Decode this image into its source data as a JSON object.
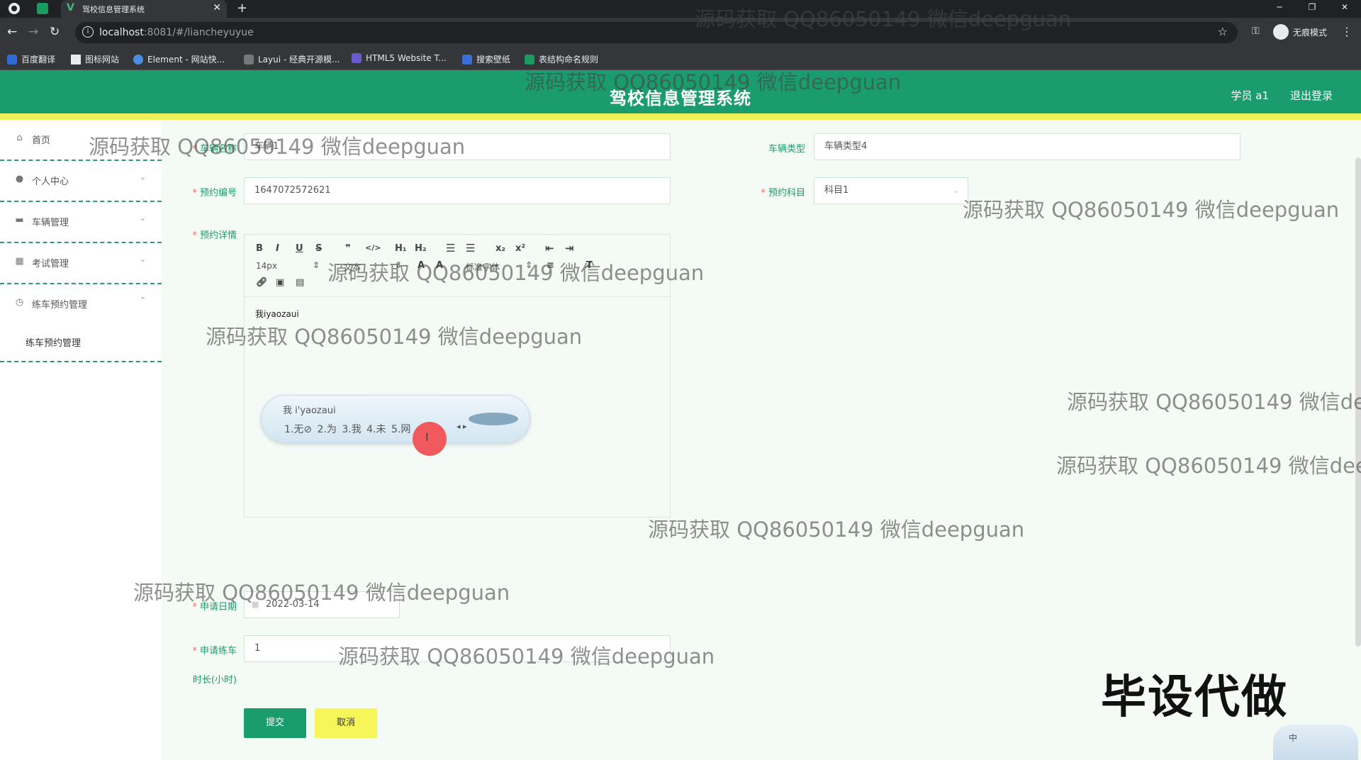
{
  "browser": {
    "tab_title": "驾校信息管理系统",
    "url_host": "localhost",
    "url_rest": ":8081/#/liancheyuyue",
    "incognito_label": "无痕模式",
    "bookmarks": [
      "百度翻译",
      "图标网站",
      "Element - 网站快...",
      "Layui - 经典开源模...",
      "HTML5 Website T...",
      "搜索壁纸",
      "表结构命名规则"
    ]
  },
  "header": {
    "title": "驾校信息管理系统",
    "user": "学员 a1",
    "logout": "退出登录"
  },
  "sidebar": {
    "items": [
      {
        "label": "首页",
        "icon": "home-icon"
      },
      {
        "label": "个人中心",
        "icon": "user-icon"
      },
      {
        "label": "车辆管理",
        "icon": "car-icon"
      },
      {
        "label": "考试管理",
        "icon": "grid-icon"
      },
      {
        "label": "练车预约管理",
        "icon": "clock-icon"
      }
    ],
    "sub_item": "练车预约管理"
  },
  "form": {
    "vehicle_name_label": "车辆名称",
    "vehicle_name_value": "车辆1",
    "vehicle_type_label": "车辆类型",
    "vehicle_type_value": "车辆类型4",
    "booking_no_label": "预约编号",
    "booking_no_value": "1647072572621",
    "subject_label": "预约科目",
    "subject_value": "科目1",
    "details_label": "预约详情",
    "editor_font_size": "14px",
    "editor_text_size": "文本",
    "editor_heading": "标准字体",
    "editor_content": "我iyaozaui",
    "ime_composition": "我 i'yaozaui",
    "ime_candidates": "1.无⊘  2.为  3.我  4.未  5.网",
    "apply_date_label": "申请日期",
    "apply_date_value": "2022-03-14",
    "hours_label": "申请练车",
    "hours_label_2": "时长(小时)",
    "hours_value": "1",
    "submit": "提交",
    "cancel": "取消"
  },
  "watermark_text": "源码获取 QQ86050149 微信deepguan",
  "stamp_text": "毕设代做",
  "ime_corner": "中",
  "colors": {
    "primary": "#1a9c6f",
    "stripe": "#f0f15a",
    "cancel_bg": "#f6f65a"
  }
}
